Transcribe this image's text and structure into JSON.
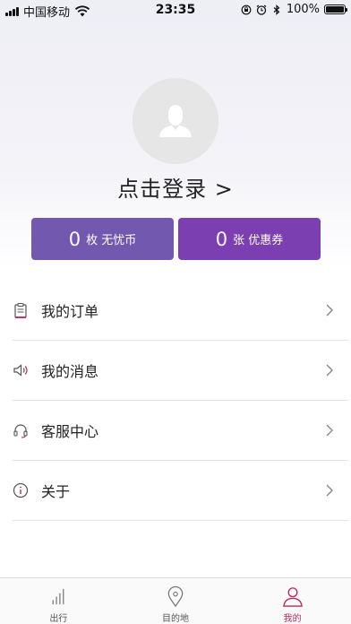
{
  "status_bar": {
    "carrier": "中国移动",
    "time": "23:35",
    "battery": "100%"
  },
  "profile": {
    "login_text": "点击登录 >",
    "avatar_icon": "user-icon"
  },
  "cards": {
    "coins": {
      "count": "0",
      "label": "枚 无忧币",
      "color": "#7358b0"
    },
    "coupons": {
      "count": "0",
      "label": "张 优惠券",
      "color": "#7c3fb1"
    }
  },
  "menu": {
    "items": [
      {
        "label": "我的订单",
        "icon": "clipboard-icon"
      },
      {
        "label": "我的消息",
        "icon": "speaker-icon"
      },
      {
        "label": "客服中心",
        "icon": "headset-icon"
      },
      {
        "label": "关于",
        "icon": "info-icon"
      }
    ]
  },
  "tabs": [
    {
      "label": "出行",
      "icon": "bar-chart-icon",
      "active": false
    },
    {
      "label": "目的地",
      "icon": "location-pin-icon",
      "active": false
    },
    {
      "label": "我的",
      "icon": "person-icon",
      "active": true
    }
  ],
  "colors": {
    "accent": "#c2255c",
    "card_left": "#7358b0",
    "card_right": "#7c3fb1"
  }
}
